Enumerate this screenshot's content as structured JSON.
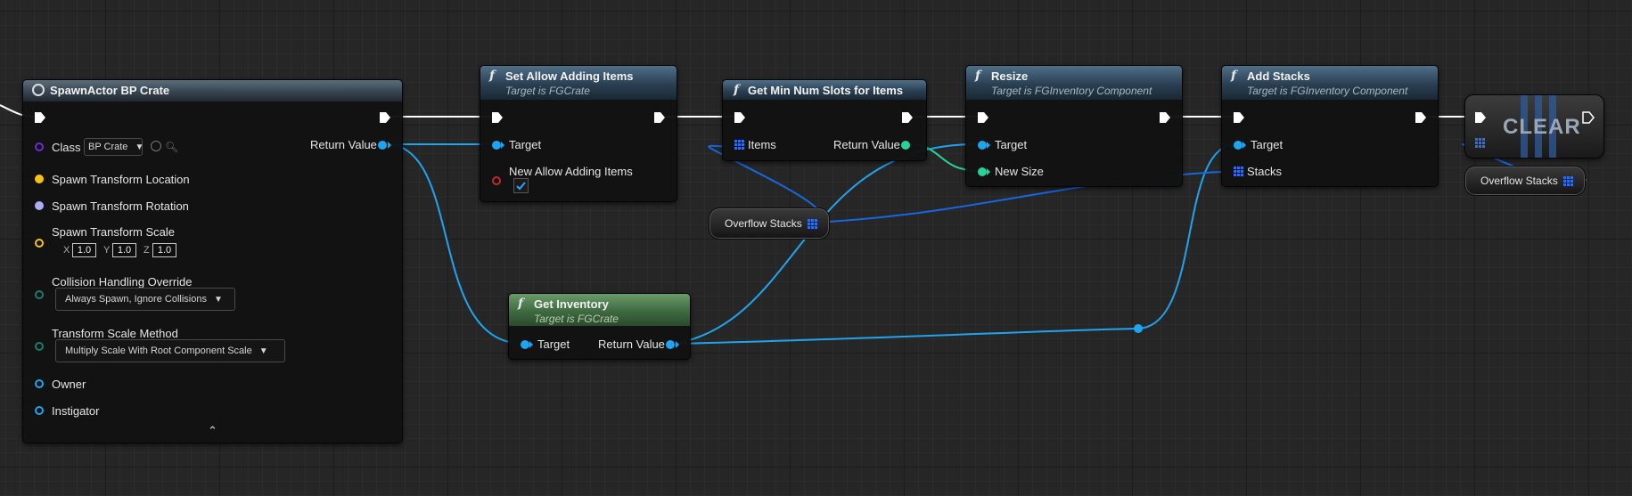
{
  "nodes": {
    "spawn_actor": {
      "title": "SpawnActor BP Crate",
      "return_label": "Return Value",
      "class_label": "Class",
      "class_value": "BP Crate",
      "location_label": "Spawn Transform Location",
      "rotation_label": "Spawn Transform Rotation",
      "scale_label": "Spawn Transform Scale",
      "scale": {
        "x_label": "X",
        "x": "1.0",
        "y_label": "Y",
        "y": "1.0",
        "z_label": "Z",
        "z": "1.0"
      },
      "collision_label": "Collision Handling Override",
      "collision_value": "Always Spawn, Ignore Collisions",
      "scale_method_label": "Transform Scale Method",
      "scale_method_value": "Multiply Scale With Root Component Scale",
      "owner_label": "Owner",
      "instigator_label": "Instigator"
    },
    "set_allow": {
      "title": "Set Allow Adding Items",
      "subtitle": "Target is FGCrate",
      "target_label": "Target",
      "allow_label": "New Allow Adding Items",
      "allow_checked": true
    },
    "get_min": {
      "title": "Get Min Num Slots for Items",
      "items_label": "Items",
      "return_label": "Return Value"
    },
    "resize": {
      "title": "Resize",
      "subtitle": "Target is FGInventory Component",
      "target_label": "Target",
      "size_label": "New Size"
    },
    "add_stacks": {
      "title": "Add Stacks",
      "subtitle": "Target is FGInventory Component",
      "target_label": "Target",
      "stacks_label": "Stacks"
    },
    "clear": {
      "title": "CLEAR"
    },
    "get_inventory": {
      "title": "Get Inventory",
      "subtitle": "Target is FGCrate",
      "target_label": "Target",
      "return_label": "Return Value"
    },
    "overflow_var_1": {
      "label": "Overflow Stacks"
    },
    "overflow_var_2": {
      "label": "Overflow Stacks"
    }
  },
  "colors": {
    "exec": "#ffffff",
    "object": "#1fa4ef",
    "integer": "#27d39a",
    "struct_location": "#f5c218",
    "struct_rotation": "#a9aef5",
    "bool": "#c42a2a"
  }
}
